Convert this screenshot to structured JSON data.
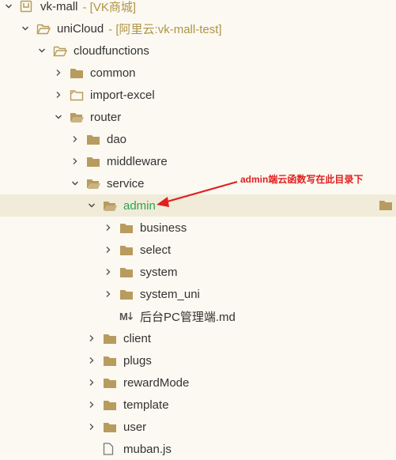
{
  "tree": [
    {
      "label": "vk-mall",
      "extra": "- [VK商城]",
      "icon": "project-icon",
      "chevron": "down",
      "depth": 0
    },
    {
      "label": "uniCloud",
      "extra": "- [阿里云:vk-mall-test]",
      "icon": "cloud-folder-icon",
      "chevron": "down",
      "depth": 1
    },
    {
      "label": "cloudfunctions",
      "extra": "",
      "icon": "folder-open-outline-icon",
      "chevron": "down",
      "depth": 2
    },
    {
      "label": "common",
      "extra": "",
      "icon": "folder-icon",
      "chevron": "right",
      "depth": 3
    },
    {
      "label": "import-excel",
      "extra": "",
      "icon": "cloud-function-folder-icon",
      "chevron": "right",
      "depth": 3
    },
    {
      "label": "router",
      "extra": "",
      "icon": "folder-open-icon",
      "chevron": "down",
      "depth": 3
    },
    {
      "label": "dao",
      "extra": "",
      "icon": "folder-icon",
      "chevron": "right",
      "depth": 4
    },
    {
      "label": "middleware",
      "extra": "",
      "icon": "folder-icon",
      "chevron": "right",
      "depth": 4
    },
    {
      "label": "service",
      "extra": "",
      "icon": "folder-open-icon",
      "chevron": "down",
      "depth": 4
    },
    {
      "label": "admin",
      "extra": "",
      "icon": "folder-open-icon",
      "chevron": "down",
      "depth": 5,
      "selected": true
    },
    {
      "label": "business",
      "extra": "",
      "icon": "folder-icon",
      "chevron": "right",
      "depth": 6
    },
    {
      "label": "select",
      "extra": "",
      "icon": "folder-icon",
      "chevron": "right",
      "depth": 6
    },
    {
      "label": "system",
      "extra": "",
      "icon": "folder-icon",
      "chevron": "right",
      "depth": 6
    },
    {
      "label": "system_uni",
      "extra": "",
      "icon": "folder-icon",
      "chevron": "right",
      "depth": 6
    },
    {
      "label": "后台PC管理端.md",
      "extra": "",
      "icon": "markdown-icon",
      "chevron": "none",
      "depth": 6
    },
    {
      "label": "client",
      "extra": "",
      "icon": "folder-icon",
      "chevron": "right",
      "depth": 5
    },
    {
      "label": "plugs",
      "extra": "",
      "icon": "folder-icon",
      "chevron": "right",
      "depth": 5
    },
    {
      "label": "rewardMode",
      "extra": "",
      "icon": "folder-icon",
      "chevron": "right",
      "depth": 5
    },
    {
      "label": "template",
      "extra": "",
      "icon": "folder-icon",
      "chevron": "right",
      "depth": 5
    },
    {
      "label": "user",
      "extra": "",
      "icon": "folder-icon",
      "chevron": "right",
      "depth": 5
    },
    {
      "label": "muban.js",
      "extra": "",
      "icon": "file-icon",
      "chevron": "none",
      "depth": 5
    }
  ],
  "annotation": {
    "text": "admin端云函数写在此目录下",
    "color": "#e02020"
  },
  "colors": {
    "folder": "#b89b5e",
    "selected_text": "#2da44e",
    "extra_text": "#b09446",
    "background": "#fbf9f1",
    "selected_row": "#f0ecd9"
  }
}
